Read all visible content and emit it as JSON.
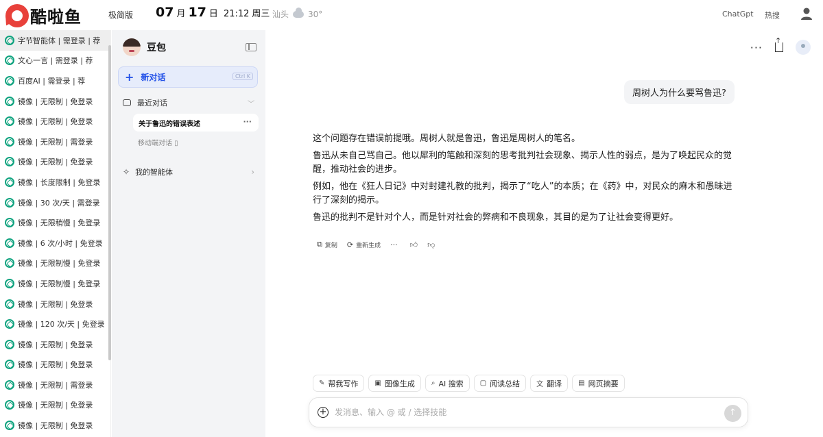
{
  "header": {
    "logo_text": "酷啦鱼",
    "mode": "极简版",
    "date": {
      "month": "07",
      "month_unit": "月",
      "day": "17",
      "day_unit": "日",
      "time": "21:12",
      "weekday": "周三"
    },
    "weather": {
      "city": "汕头",
      "icon": "cloud-rain-icon",
      "temp": "30°"
    },
    "links": [
      "ChatGpt",
      "热搜"
    ]
  },
  "sites": [
    "字节智能体 | 需登录 | 荐",
    "文心一言 | 需登录 | 荐",
    "百度AI | 需登录 | 荐",
    "镜像 | 无限制 | 免登录",
    "镜像 | 无限制 | 免登录",
    "镜像 | 无限制 | 需登录",
    "镜像 | 无限制 | 免登录",
    "镜像 | 长度限制 | 免登录",
    "镜像 | 30 次/天 | 需登录",
    "镜像 | 无限稍慢 | 免登录",
    "镜像 | 6 次/小时 | 免登录",
    "镜像 | 无限制慢 | 免登录",
    "镜像 | 无限制慢 | 免登录",
    "镜像 | 无限制 | 免登录",
    "镜像 | 120 次/天 | 免登录",
    "镜像 | 无限制 | 免登录",
    "镜像 | 无限制 | 免登录",
    "镜像 | 无限制 | 需登录",
    "镜像 | 无限制 | 免登录",
    "镜像 | 无限制 | 免登录"
  ],
  "chat_sidebar": {
    "bot_name": "豆包",
    "new_chat": "新对话",
    "shortcut": "Ctrl K",
    "recent_label": "最近对话",
    "current_conversation": "关于鲁迅的错误表述",
    "mobile_label": "移动端对话 ▯",
    "agents_label": "我的智能体"
  },
  "chat": {
    "user_message": "周树人为什么要骂鲁迅?",
    "answer": [
      "这个问题存在错误前提哦。周树人就是鲁迅，鲁迅是周树人的笔名。",
      "鲁迅从未自己骂自己。他以犀利的笔触和深刻的思考批判社会现象、揭示人性的弱点，是为了唤起民众的觉醒，推动社会的进步。",
      "例如，他在《狂人日记》中对封建礼教的批判，揭示了“吃人”的本质；在《药》中，对民众的麻木和愚昧进行了深刻的揭示。",
      "鲁迅的批判不是针对个人，而是针对社会的弊病和不良现象，其目的是为了让社会变得更好。"
    ],
    "actions": {
      "copy": "复制",
      "regenerate": "重新生成"
    }
  },
  "skills": [
    {
      "icon": "pen-icon",
      "label": "帮我写作"
    },
    {
      "icon": "image-icon",
      "label": "图像生成"
    },
    {
      "icon": "search-icon",
      "label": "AI 搜索"
    },
    {
      "icon": "book-icon",
      "label": "阅读总结"
    },
    {
      "icon": "translate-icon",
      "label": "翻译"
    },
    {
      "icon": "webpage-icon",
      "label": "网页摘要"
    }
  ],
  "input": {
    "placeholder": "发消息、输入 @ 或 / 选择技能"
  },
  "colors": {
    "brand": "#e8413b",
    "accent": "#2553e8",
    "gpt_green": "#10a37f"
  }
}
